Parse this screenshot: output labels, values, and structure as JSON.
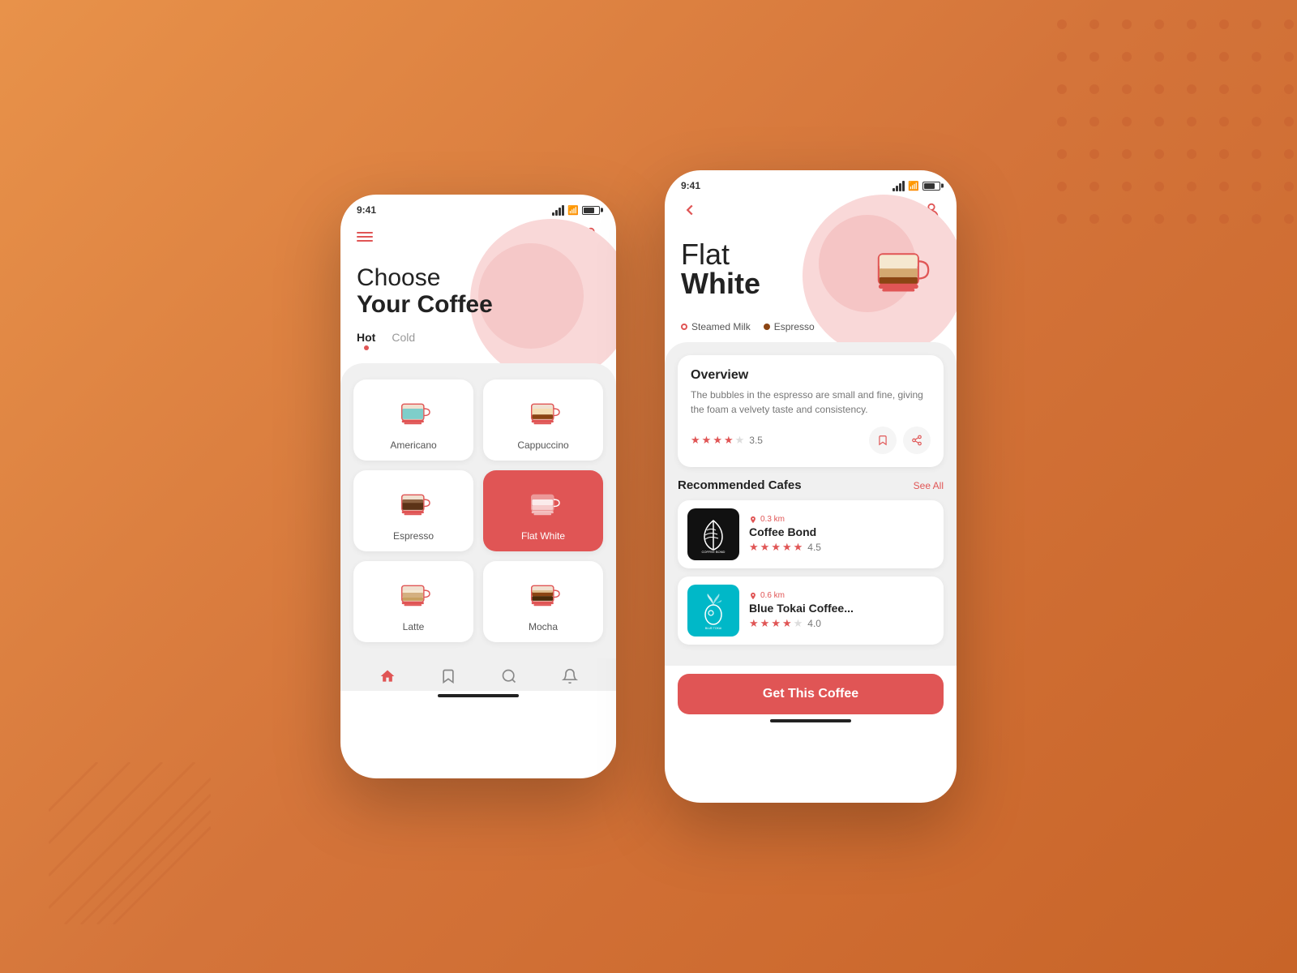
{
  "background": {
    "gradient_start": "#e8924a",
    "gradient_end": "#c86428"
  },
  "left_phone": {
    "status": {
      "time": "9:41"
    },
    "header": {
      "menu_label": "menu",
      "user_label": "user"
    },
    "title": {
      "line1": "Choose",
      "line2": "Your Coffee"
    },
    "tabs": [
      {
        "label": "Hot",
        "active": true
      },
      {
        "label": "Cold",
        "active": false
      }
    ],
    "coffees": [
      {
        "name": "Americano",
        "selected": false,
        "type": "americano"
      },
      {
        "name": "Cappuccino",
        "selected": false,
        "type": "cappuccino"
      },
      {
        "name": "Espresso",
        "selected": false,
        "type": "espresso"
      },
      {
        "name": "Flat White",
        "selected": true,
        "type": "flatwhite"
      },
      {
        "name": "Latte",
        "selected": false,
        "type": "latte"
      },
      {
        "name": "Mocha",
        "selected": false,
        "type": "mocha"
      }
    ],
    "nav": [
      {
        "icon": "home",
        "active": true
      },
      {
        "icon": "bookmark",
        "active": false
      },
      {
        "icon": "search",
        "active": false
      },
      {
        "icon": "bell",
        "active": false
      }
    ]
  },
  "right_phone": {
    "status": {
      "time": "9:41"
    },
    "coffee_name_line1": "Flat",
    "coffee_name_line2": "White",
    "ingredients": [
      {
        "name": "Steamed Milk",
        "type": "milk"
      },
      {
        "name": "Espresso",
        "type": "espresso"
      }
    ],
    "overview": {
      "title": "Overview",
      "description": "The bubbles in the espresso are small and fine, giving the foam a velvety taste and consistency.",
      "rating": "3.5"
    },
    "recommended_section": {
      "title": "Recommended Cafes",
      "see_all": "See All"
    },
    "cafes": [
      {
        "name": "Coffee Bond",
        "distance": "0.3 km",
        "rating": "4.5",
        "type": "bond"
      },
      {
        "name": "Blue Tokai Coffee...",
        "distance": "0.6 km",
        "rating": "4.0",
        "type": "tokai"
      }
    ],
    "cta_button": "Get This Coffee"
  }
}
